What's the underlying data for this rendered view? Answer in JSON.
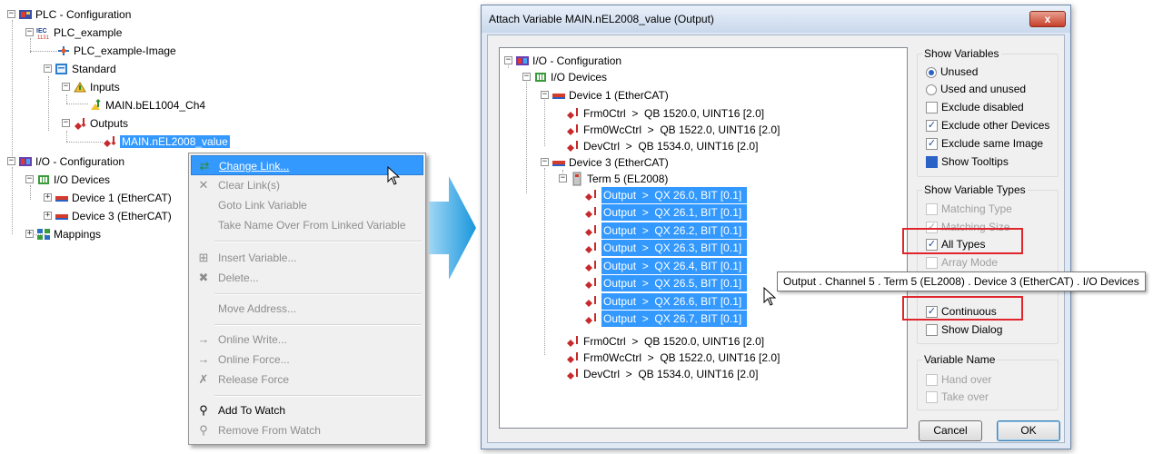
{
  "left_tree": {
    "plc_config": "PLC - Configuration",
    "plc_example": "PLC_example",
    "plc_image": "PLC_example-Image",
    "standard": "Standard",
    "inputs": "Inputs",
    "input_var": "MAIN.bEL1004_Ch4",
    "outputs": "Outputs",
    "output_var": "MAIN.nEL2008_value",
    "io_config": "I/O - Configuration",
    "io_devices": "I/O Devices",
    "device1": "Device 1 (EtherCAT)",
    "device3": "Device 3 (EtherCAT)",
    "mappings": "Mappings"
  },
  "context_menu": {
    "change_link": "Change Link...",
    "clear_links": "Clear Link(s)",
    "goto_link": "Goto Link Variable",
    "take_name": "Take Name Over From Linked Variable",
    "insert_var": "Insert Variable...",
    "delete": "Delete...",
    "move_address": "Move Address...",
    "online_write": "Online Write...",
    "online_force": "Online Force...",
    "release_force": "Release Force",
    "add_watch": "Add To Watch",
    "remove_watch": "Remove From Watch"
  },
  "dialog": {
    "title": "Attach Variable MAIN.nEL2008_value (Output)",
    "close": "x",
    "tree": {
      "io_config": "I/O - Configuration",
      "io_devices": "I/O Devices",
      "device1": "Device 1 (EtherCAT)",
      "d1_rows": [
        "Frm0Ctrl  >  QB 1520.0, UINT16 [2.0]",
        "Frm0WcCtrl  >  QB 1522.0, UINT16 [2.0]",
        "DevCtrl  >  QB 1534.0, UINT16 [2.0]"
      ],
      "device3": "Device 3 (EtherCAT)",
      "term5": "Term 5 (EL2008)",
      "outputs": [
        "Output  >  QX 26.0, BIT [0.1]",
        "Output  >  QX 26.1, BIT [0.1]",
        "Output  >  QX 26.2, BIT [0.1]",
        "Output  >  QX 26.3, BIT [0.1]",
        "Output  >  QX 26.4, BIT [0.1]",
        "Output  >  QX 26.5, BIT [0.1]",
        "Output  >  QX 26.6, BIT [0.1]",
        "Output  >  QX 26.7, BIT [0.1]"
      ],
      "d3_rows": [
        "Frm0Ctrl  >  QB 1520.0, UINT16 [2.0]",
        "Frm0WcCtrl  >  QB 1522.0, UINT16 [2.0]",
        "DevCtrl  >  QB 1534.0, UINT16 [2.0]"
      ]
    },
    "show_variables": {
      "title": "Show Variables",
      "unused": "Unused",
      "used_unused": "Used and unused",
      "excl_disabled": "Exclude disabled",
      "excl_other": "Exclude other Devices",
      "excl_same": "Exclude same Image",
      "tooltips": "Show Tooltips"
    },
    "show_types": {
      "title": "Show Variable Types",
      "matching_type": "Matching Type",
      "matching_size": "Matching Size",
      "all_types": "All Types",
      "array_mode": "Array Mode",
      "continuous": "Continuous",
      "show_dialog": "Show Dialog"
    },
    "variable_name": {
      "title": "Variable Name",
      "hand_over": "Hand over",
      "take_over": "Take over"
    },
    "cancel": "Cancel",
    "ok": "OK"
  },
  "tooltip": "Output . Channel 5 . Term 5 (EL2008) . Device 3 (EtherCAT) . I/O Devices",
  "colors": {
    "selection": "#3399ff",
    "arrow": "#1f9de0",
    "highlight_box": "#e0262c"
  }
}
